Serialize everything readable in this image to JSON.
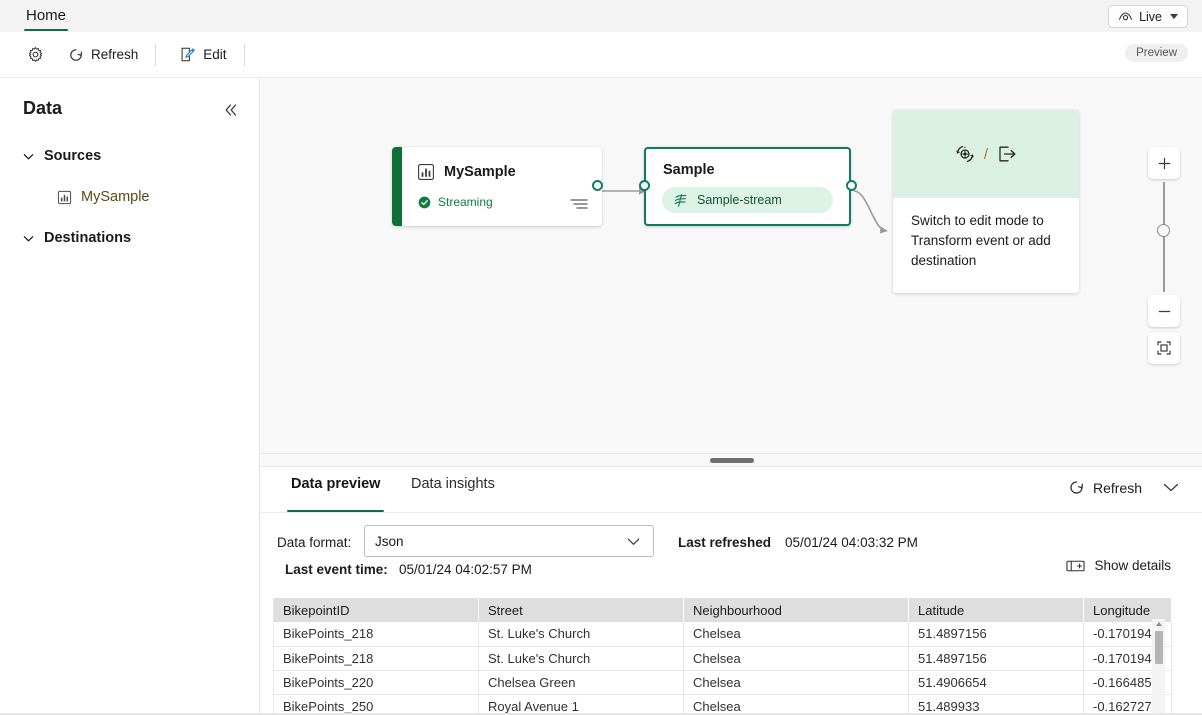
{
  "titlebar": {
    "tab_label": "Home",
    "live_label": "Live",
    "live_icon": "eye-icon",
    "caret_icon": "chevron-down-icon"
  },
  "commandbar": {
    "settings_icon": "gear-icon",
    "refresh_label": "Refresh",
    "refresh_icon": "refresh-circular-arrow-icon",
    "edit_label": "Edit",
    "edit_icon": "edit-pencil-icon",
    "preview_badge": "Preview"
  },
  "sidebar": {
    "title": "Data",
    "collapse_icon": "double-chevron-left-icon",
    "groups": [
      {
        "label": "Sources",
        "expand_icon": "chevron-down-icon",
        "items": [
          {
            "label": "MySample",
            "icon": "bar-chart-icon"
          }
        ]
      },
      {
        "label": "Destinations",
        "expand_icon": "chevron-down-icon",
        "items": []
      }
    ]
  },
  "canvas": {
    "source_node": {
      "title": "MySample",
      "icon": "bar-chart-icon",
      "status": "Streaming",
      "status_icon": "check-circle-icon",
      "menu_icon": "list-menu-icon",
      "accent_color": "#0e7034"
    },
    "stream_node": {
      "title": "Sample",
      "pill_label": "Sample-stream",
      "pill_icon": "stream-wave-icon",
      "border_color": "#0f7b5f",
      "pill_bg": "#ddf3e6"
    },
    "hint_node": {
      "transform_icon": "transform-gear-refresh-icon",
      "separator": "/",
      "destination_icon": "export-arrow-icon",
      "text": "Switch to edit mode to Transform event or add destination",
      "header_bg": "#d9f0e3"
    },
    "zoom_controls": {
      "zoom_in_icon": "plus-icon",
      "zoom_out_icon": "minus-icon",
      "fit_icon": "fit-to-screen-icon"
    },
    "port_color": "#0f7b6c"
  },
  "bottom_pane": {
    "tabs": [
      {
        "label": "Data preview",
        "active": true
      },
      {
        "label": "Data insights",
        "active": false
      }
    ],
    "refresh_label": "Refresh",
    "refresh_icon": "refresh-circular-arrow-icon",
    "collapse_icon": "chevron-down-icon",
    "data_format_label": "Data format:",
    "data_format_value": "Json",
    "data_format_caret": "chevron-down-icon",
    "last_event_label": "Last event time:",
    "last_event_value": "05/01/24 04:02:57 PM",
    "last_refreshed_label": "Last refreshed",
    "last_refreshed_value": "05/01/24 04:03:32 PM",
    "show_details_label": "Show details",
    "show_details_icon": "details-panel-icon",
    "table": {
      "columns": [
        "BikepointID",
        "Street",
        "Neighbourhood",
        "Latitude",
        "Longitude"
      ],
      "rows": [
        [
          "BikePoints_218",
          "St. Luke's Church",
          "Chelsea",
          "51.4897156",
          "-0.170194"
        ],
        [
          "BikePoints_218",
          "St. Luke's Church",
          "Chelsea",
          "51.4897156",
          "-0.170194"
        ],
        [
          "BikePoints_220",
          "Chelsea Green",
          "Chelsea",
          "51.4906654",
          "-0.166485"
        ],
        [
          "BikePoints_250",
          "Royal Avenue 1",
          "Chelsea",
          "51.489933",
          "-0.162727"
        ]
      ]
    }
  }
}
